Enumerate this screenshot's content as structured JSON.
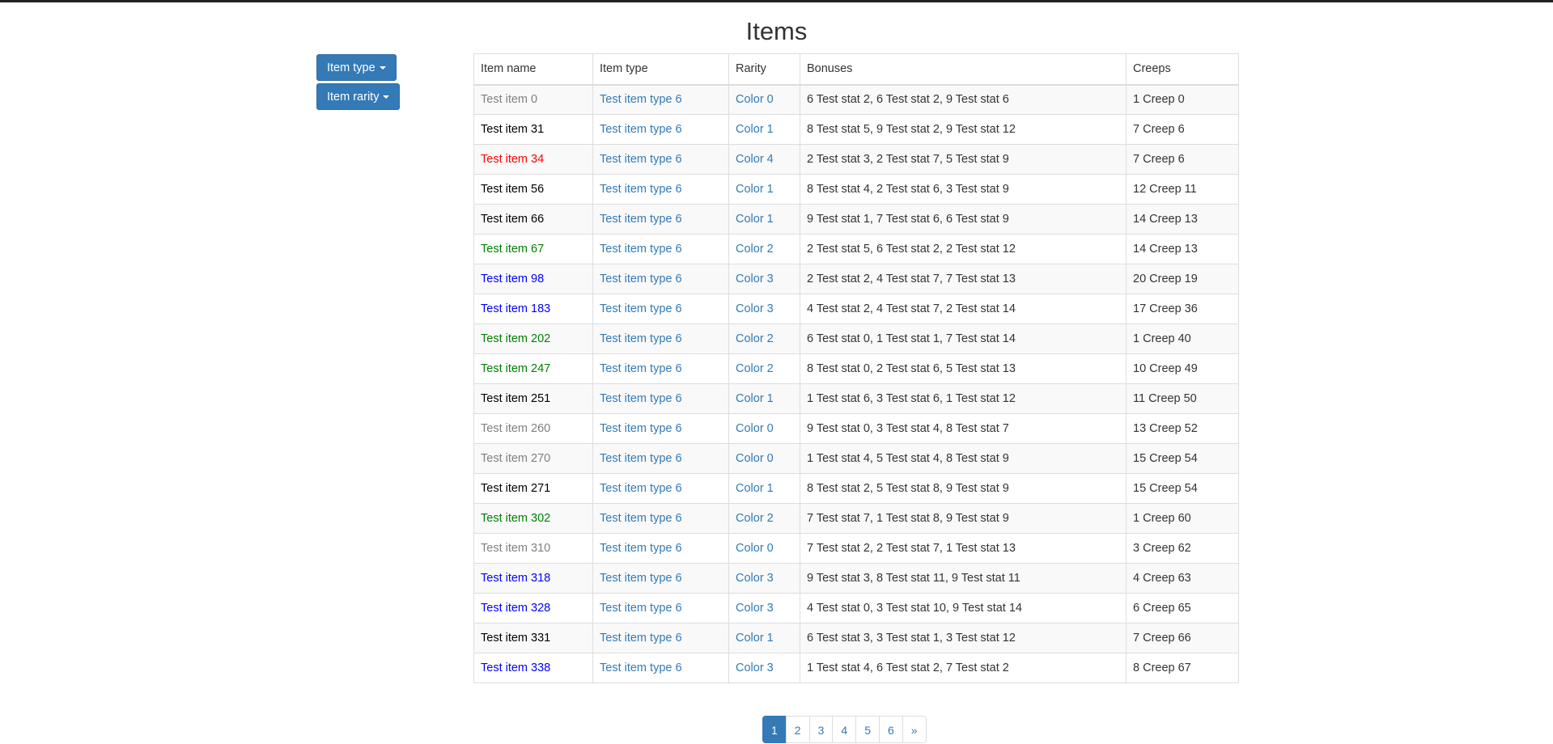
{
  "page": {
    "title": "Items"
  },
  "filters": {
    "item_type_label": "Item type",
    "item_rarity_label": "Item rarity"
  },
  "colors": {
    "accent": "#337ab7",
    "rarity_colors": {
      "Color 0": "#808080",
      "Color 1": "#000000",
      "Color 2": "#008000",
      "Color 3": "#0000ff",
      "Color 4": "#ff0000"
    }
  },
  "table": {
    "headers": [
      "Item name",
      "Item type",
      "Rarity",
      "Bonuses",
      "Creeps"
    ],
    "rows": [
      {
        "name": "Test item 0",
        "type": "Test item type 6",
        "rarity": "Color 0",
        "bonuses": "6 Test stat 2, 6 Test stat 2, 9 Test stat 6",
        "creeps": "1 Creep 0"
      },
      {
        "name": "Test item 31",
        "type": "Test item type 6",
        "rarity": "Color 1",
        "bonuses": "8 Test stat 5, 9 Test stat 2, 9 Test stat 12",
        "creeps": "7 Creep 6"
      },
      {
        "name": "Test item 34",
        "type": "Test item type 6",
        "rarity": "Color 4",
        "bonuses": "2 Test stat 3, 2 Test stat 7, 5 Test stat 9",
        "creeps": "7 Creep 6"
      },
      {
        "name": "Test item 56",
        "type": "Test item type 6",
        "rarity": "Color 1",
        "bonuses": "8 Test stat 4, 2 Test stat 6, 3 Test stat 9",
        "creeps": "12 Creep 11"
      },
      {
        "name": "Test item 66",
        "type": "Test item type 6",
        "rarity": "Color 1",
        "bonuses": "9 Test stat 1, 7 Test stat 6, 6 Test stat 9",
        "creeps": "14 Creep 13"
      },
      {
        "name": "Test item 67",
        "type": "Test item type 6",
        "rarity": "Color 2",
        "bonuses": "2 Test stat 5, 6 Test stat 2, 2 Test stat 12",
        "creeps": "14 Creep 13"
      },
      {
        "name": "Test item 98",
        "type": "Test item type 6",
        "rarity": "Color 3",
        "bonuses": "2 Test stat 2, 4 Test stat 7, 7 Test stat 13",
        "creeps": "20 Creep 19"
      },
      {
        "name": "Test item 183",
        "type": "Test item type 6",
        "rarity": "Color 3",
        "bonuses": "4 Test stat 2, 4 Test stat 7, 2 Test stat 14",
        "creeps": "17 Creep 36"
      },
      {
        "name": "Test item 202",
        "type": "Test item type 6",
        "rarity": "Color 2",
        "bonuses": "6 Test stat 0, 1 Test stat 1, 7 Test stat 14",
        "creeps": "1 Creep 40"
      },
      {
        "name": "Test item 247",
        "type": "Test item type 6",
        "rarity": "Color 2",
        "bonuses": "8 Test stat 0, 2 Test stat 6, 5 Test stat 13",
        "creeps": "10 Creep 49"
      },
      {
        "name": "Test item 251",
        "type": "Test item type 6",
        "rarity": "Color 1",
        "bonuses": "1 Test stat 6, 3 Test stat 6, 1 Test stat 12",
        "creeps": "11 Creep 50"
      },
      {
        "name": "Test item 260",
        "type": "Test item type 6",
        "rarity": "Color 0",
        "bonuses": "9 Test stat 0, 3 Test stat 4, 8 Test stat 7",
        "creeps": "13 Creep 52"
      },
      {
        "name": "Test item 270",
        "type": "Test item type 6",
        "rarity": "Color 0",
        "bonuses": "1 Test stat 4, 5 Test stat 4, 8 Test stat 9",
        "creeps": "15 Creep 54"
      },
      {
        "name": "Test item 271",
        "type": "Test item type 6",
        "rarity": "Color 1",
        "bonuses": "8 Test stat 2, 5 Test stat 8, 9 Test stat 9",
        "creeps": "15 Creep 54"
      },
      {
        "name": "Test item 302",
        "type": "Test item type 6",
        "rarity": "Color 2",
        "bonuses": "7 Test stat 7, 1 Test stat 8, 9 Test stat 9",
        "creeps": "1 Creep 60"
      },
      {
        "name": "Test item 310",
        "type": "Test item type 6",
        "rarity": "Color 0",
        "bonuses": "7 Test stat 2, 2 Test stat 7, 1 Test stat 13",
        "creeps": "3 Creep 62"
      },
      {
        "name": "Test item 318",
        "type": "Test item type 6",
        "rarity": "Color 3",
        "bonuses": "9 Test stat 3, 8 Test stat 11, 9 Test stat 11",
        "creeps": "4 Creep 63"
      },
      {
        "name": "Test item 328",
        "type": "Test item type 6",
        "rarity": "Color 3",
        "bonuses": "4 Test stat 0, 3 Test stat 10, 9 Test stat 14",
        "creeps": "6 Creep 65"
      },
      {
        "name": "Test item 331",
        "type": "Test item type 6",
        "rarity": "Color 1",
        "bonuses": "6 Test stat 3, 3 Test stat 1, 3 Test stat 12",
        "creeps": "7 Creep 66"
      },
      {
        "name": "Test item 338",
        "type": "Test item type 6",
        "rarity": "Color 3",
        "bonuses": "1 Test stat 4, 6 Test stat 2, 7 Test stat 2",
        "creeps": "8 Creep 67"
      }
    ]
  },
  "pagination": {
    "pages": [
      "1",
      "2",
      "3",
      "4",
      "5",
      "6"
    ],
    "active": "1",
    "next_label": "»"
  }
}
